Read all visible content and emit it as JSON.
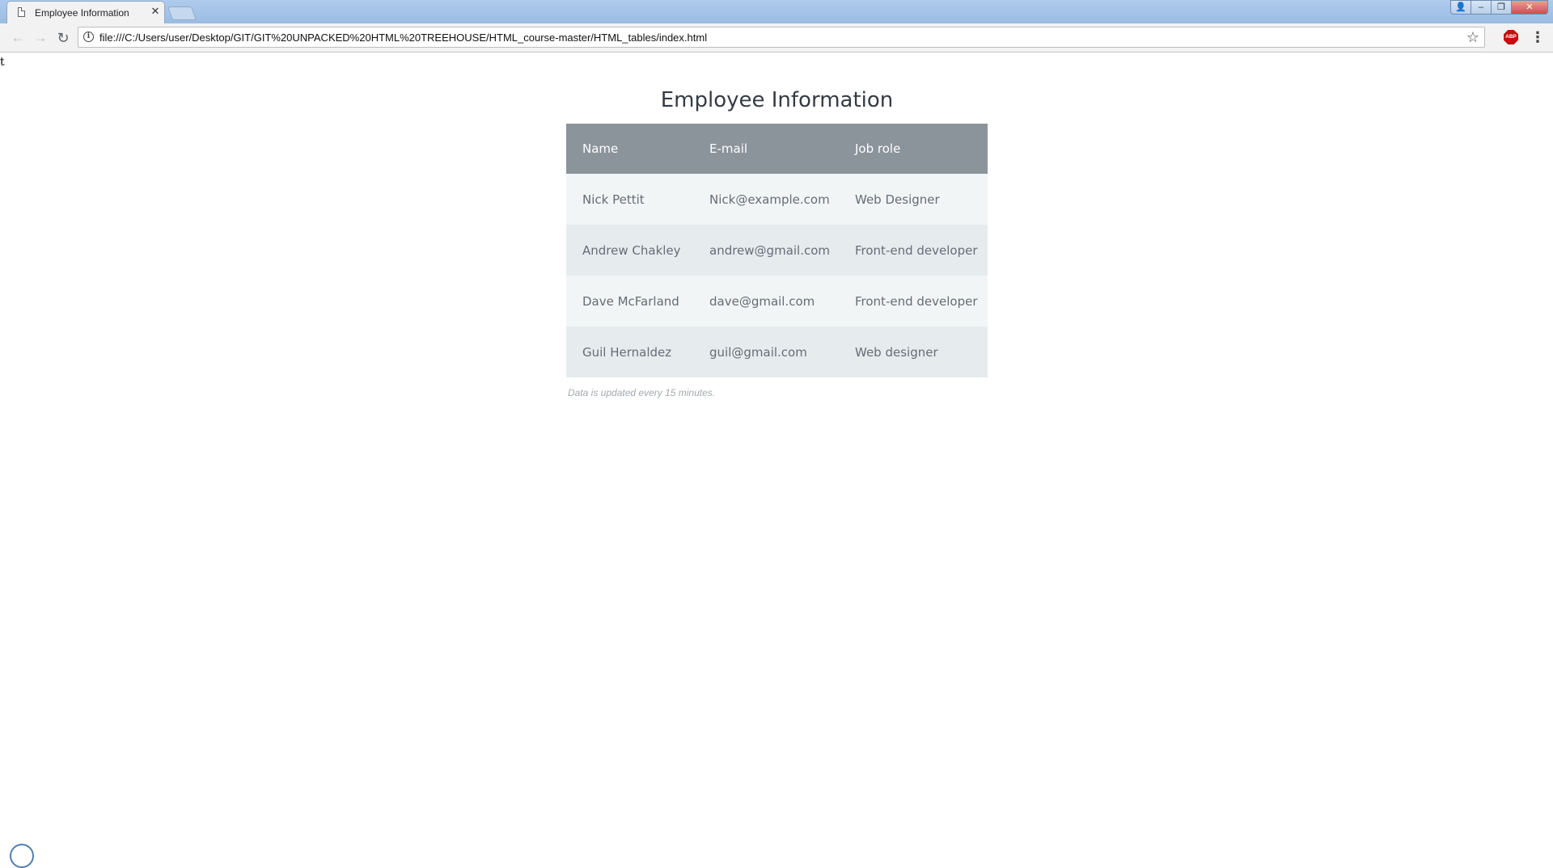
{
  "browser": {
    "tab_title": "Employee Information",
    "tab_close": "✕",
    "url": "file:///C:/Users/user/Desktop/GIT/GIT%20UNPACKED%20HTML%20TREEHOUSE/HTML_course-master/HTML_tables/index.html",
    "info_glyph": "i",
    "abp_label": "ABP",
    "window_buttons": {
      "user": "👤",
      "minimize": "‒",
      "restore": "❐",
      "close": "✕"
    }
  },
  "page": {
    "stray_text": "t",
    "caption": "Employee Information",
    "headers": [
      "Name",
      "E-mail",
      "Job role"
    ],
    "rows": [
      [
        "Nick Pettit",
        "Nick@example.com",
        "Web Designer"
      ],
      [
        "Andrew Chakley",
        "andrew@gmail.com",
        "Front-end developer"
      ],
      [
        "Dave McFarland",
        "dave@gmail.com",
        "Front-end developer"
      ],
      [
        "Guil Hernaldez",
        "guil@gmail.com",
        "Web designer"
      ]
    ],
    "footnote": "Data is updated every 15 minutes."
  },
  "colors": {
    "header_bg": "#8b949b",
    "row_odd": "#f2f5f6",
    "row_even": "#e6ecee",
    "cell_text": "#666c74"
  }
}
